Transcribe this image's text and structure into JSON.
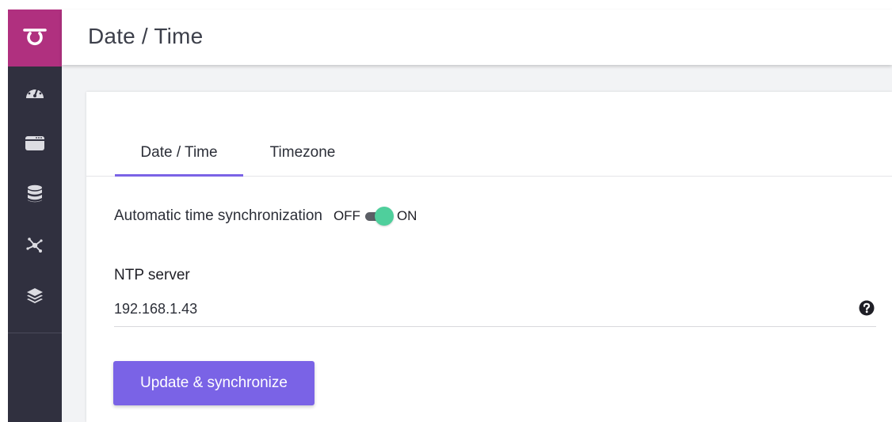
{
  "header": {
    "title": "Date / Time"
  },
  "sidebar": {
    "items": [
      {
        "icon": "dashboard-icon"
      },
      {
        "icon": "window-icon"
      },
      {
        "icon": "database-icon"
      },
      {
        "icon": "network-icon"
      },
      {
        "icon": "layers-icon"
      }
    ]
  },
  "tabs": [
    {
      "label": "Date / Time",
      "active": true
    },
    {
      "label": "Timezone",
      "active": false
    }
  ],
  "sync": {
    "label": "Automatic time synchronization",
    "off_label": "OFF",
    "on_label": "ON",
    "enabled": true
  },
  "ntp": {
    "label": "NTP server",
    "value": "192.168.1.43"
  },
  "actions": {
    "update_label": "Update & synchronize"
  },
  "colors": {
    "brand": "#b0307f",
    "sidebar": "#30303f",
    "accent": "#7a63e6",
    "toggle_on": "#4fcf9c"
  }
}
